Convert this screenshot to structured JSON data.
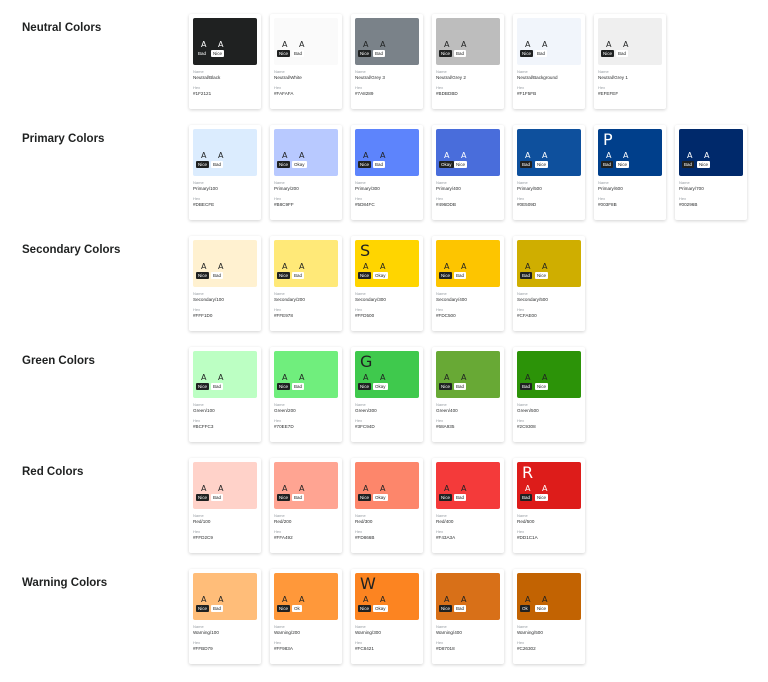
{
  "meta": {
    "name_label": "Name",
    "hex_label": "Hex"
  },
  "sections": [
    {
      "title": "Neutral Colors",
      "cards": [
        {
          "name": "Neutral/Black",
          "hex": "#1F2121",
          "color": "#1f2121",
          "text": "#ffffff",
          "big": "",
          "chips": [
            "Bad",
            "Nice"
          ]
        },
        {
          "name": "Neutral/White",
          "hex": "#FAFAFA",
          "color": "#fafafa",
          "text": "#1f2121",
          "big": "",
          "chips": [
            "Nice",
            "Bad"
          ]
        },
        {
          "name": "Neutral/Grey 3",
          "hex": "#7A8289",
          "color": "#7a8289",
          "text": "#1f2121",
          "big": "",
          "chips": [
            "Nice",
            "Bad"
          ]
        },
        {
          "name": "Neutral/Grey 2",
          "hex": "#BDBDBD",
          "color": "#bdbdbd",
          "text": "#1f2121",
          "big": "",
          "chips": [
            "Nice",
            "Bad"
          ]
        },
        {
          "name": "Neutral/Background",
          "hex": "#F1F5FB",
          "color": "#f1f5fb",
          "text": "#1f2121",
          "big": "",
          "chips": [
            "Nice",
            "Bad"
          ]
        },
        {
          "name": "Neutral/Grey 1",
          "hex": "#EFEFEF",
          "color": "#efefef",
          "text": "#1f2121",
          "big": "",
          "chips": [
            "Nice",
            "Bad"
          ]
        }
      ]
    },
    {
      "title": "Primary Colors",
      "cards": [
        {
          "name": "Primary/100",
          "hex": "#DBECFE",
          "color": "#dbecfe",
          "text": "#1f2121",
          "big": "",
          "chips": [
            "Nice",
            "Bad"
          ]
        },
        {
          "name": "Primary/200",
          "hex": "#B8C9FF",
          "color": "#b8c9ff",
          "text": "#1f2121",
          "big": "",
          "chips": [
            "Nice",
            "Okay"
          ]
        },
        {
          "name": "Primary/300",
          "hex": "#5D84FC",
          "color": "#5d84fc",
          "text": "#1f2121",
          "big": "",
          "chips": [
            "Nice",
            "Bad"
          ]
        },
        {
          "name": "Primary/400",
          "hex": "#496DDB",
          "color": "#496ddb",
          "text": "#ffffff",
          "big": "",
          "chips": [
            "Okay",
            "Nice"
          ]
        },
        {
          "name": "Primary/500",
          "hex": "#0E509D",
          "color": "#0e509d",
          "text": "#ffffff",
          "big": "",
          "chips": [
            "Bad",
            "Nice"
          ]
        },
        {
          "name": "Primary/600",
          "hex": "#003F8B",
          "color": "#003f8b",
          "text": "#ffffff",
          "big": "P",
          "chips": [
            "Bad",
            "Nice"
          ]
        },
        {
          "name": "Primary/700",
          "hex": "#00296B",
          "color": "#00296b",
          "text": "#ffffff",
          "big": "",
          "chips": [
            "Bad",
            "Nice"
          ]
        }
      ]
    },
    {
      "title": "Secondary Colors",
      "cards": [
        {
          "name": "Secondary/100",
          "hex": "#FFF1D0",
          "color": "#fff1d0",
          "text": "#1f2121",
          "big": "",
          "chips": [
            "Nice",
            "Bad"
          ]
        },
        {
          "name": "Secondary/200",
          "hex": "#FFE978",
          "color": "#ffe978",
          "text": "#1f2121",
          "big": "",
          "chips": [
            "Nice",
            "Bad"
          ]
        },
        {
          "name": "Secondary/300",
          "hex": "#FFD500",
          "color": "#ffd500",
          "text": "#1f2121",
          "big": "S",
          "chips": [
            "Nice",
            "Okay"
          ]
        },
        {
          "name": "Secondary/400",
          "hex": "#FDC500",
          "color": "#fdc500",
          "text": "#1f2121",
          "big": "",
          "chips": [
            "Nice",
            "Bad"
          ]
        },
        {
          "name": "Secondary/500",
          "hex": "#CFAE00",
          "color": "#cfae00",
          "text": "#1f2121",
          "big": "",
          "chips": [
            "Bad",
            "Nice"
          ]
        }
      ]
    },
    {
      "title": "Green Colors",
      "cards": [
        {
          "name": "Green/100",
          "hex": "#BCFFC3",
          "color": "#bcffc3",
          "text": "#1f2121",
          "big": "",
          "chips": [
            "Nice",
            "Bad"
          ]
        },
        {
          "name": "Green/200",
          "hex": "#70EE7D",
          "color": "#70ee7d",
          "text": "#1f2121",
          "big": "",
          "chips": [
            "Nice",
            "Bad"
          ]
        },
        {
          "name": "Green/300",
          "hex": "#3FC94D",
          "color": "#3fc94d",
          "text": "#1f2121",
          "big": "G",
          "chips": [
            "Nice",
            "Okay"
          ]
        },
        {
          "name": "Green/400",
          "hex": "#68A935",
          "color": "#68a935",
          "text": "#1f2121",
          "big": "",
          "chips": [
            "Nice",
            "Bad"
          ]
        },
        {
          "name": "Green/500",
          "hex": "#2C9308",
          "color": "#2c9308",
          "text": "#1f2121",
          "big": "",
          "chips": [
            "Bad",
            "Nice"
          ]
        }
      ]
    },
    {
      "title": "Red Colors",
      "cards": [
        {
          "name": "Red/100",
          "hex": "#FFD2C9",
          "color": "#ffd2c9",
          "text": "#1f2121",
          "big": "",
          "chips": [
            "Nice",
            "Bad"
          ]
        },
        {
          "name": "Red/200",
          "hex": "#FFA492",
          "color": "#ffa492",
          "text": "#1f2121",
          "big": "",
          "chips": [
            "Nice",
            "Bad"
          ]
        },
        {
          "name": "Red/300",
          "hex": "#FD866B",
          "color": "#fd866b",
          "text": "#1f2121",
          "big": "",
          "chips": [
            "Nice",
            "Okay"
          ]
        },
        {
          "name": "Red/400",
          "hex": "#F43A3A",
          "color": "#f43a3a",
          "text": "#1f2121",
          "big": "",
          "chips": [
            "Nice",
            "Bad"
          ]
        },
        {
          "name": "Red/500",
          "hex": "#DD1C1A",
          "color": "#dd1c1a",
          "text": "#ffffff",
          "big": "R",
          "chips": [
            "Bad",
            "Nice"
          ]
        }
      ]
    },
    {
      "title": "Warning Colors",
      "cards": [
        {
          "name": "Warning/100",
          "hex": "#FFBD79",
          "color": "#ffbd79",
          "text": "#1f2121",
          "big": "",
          "chips": [
            "Nice",
            "Bad"
          ]
        },
        {
          "name": "Warning/200",
          "hex": "#FF983A",
          "color": "#ff983a",
          "text": "#1f2121",
          "big": "",
          "chips": [
            "Nice",
            "Ok"
          ]
        },
        {
          "name": "Warning/300",
          "hex": "#FC8421",
          "color": "#fc8421",
          "text": "#1f2121",
          "big": "W",
          "chips": [
            "Nice",
            "Okay"
          ]
        },
        {
          "name": "Warning/400",
          "hex": "#D87018",
          "color": "#d87018",
          "text": "#1f2121",
          "big": "",
          "chips": [
            "Nice",
            "Bad"
          ]
        },
        {
          "name": "Warning/500",
          "hex": "#C26302",
          "color": "#c26302",
          "text": "#1f2121",
          "big": "",
          "chips": [
            "Ok",
            "Nice"
          ]
        }
      ]
    }
  ]
}
